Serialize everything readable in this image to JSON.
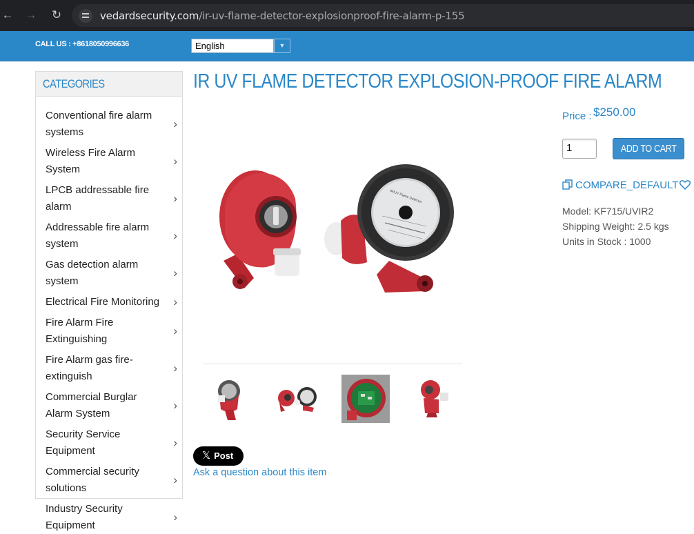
{
  "browser": {
    "back_icon": "back-arrow-icon",
    "forward_icon": "forward-arrow-icon",
    "reload_icon": "reload-icon",
    "url_domain": "vedardsecurity.com",
    "url_path": "/ir-uv-flame-detector-explosionproof-fire-alarm-p-155"
  },
  "header": {
    "call_us": "CALL US : +8618050996636",
    "language": "English"
  },
  "sidebar": {
    "title": "CATEGORIES",
    "items": [
      {
        "label": "Conventional fire alarm systems"
      },
      {
        "label": "Wireless Fire Alarm System"
      },
      {
        "label": "LPCB addressable fire alarm"
      },
      {
        "label": "Addressable fire alarm system"
      },
      {
        "label": "Gas detection alarm system"
      },
      {
        "label": "Electrical Fire Monitoring"
      },
      {
        "label": "Fire Alarm Fire Extinguishing"
      },
      {
        "label": "Fire Alarm gas fire-extinguish"
      },
      {
        "label": "Commercial Burglar Alarm System"
      },
      {
        "label": "Security Service Equipment"
      },
      {
        "label": "Commercial security solutions"
      },
      {
        "label": "Industry Security Equipment"
      }
    ]
  },
  "product": {
    "title": "IR UV FLAME DETECTOR EXPLOSION-PROOF FIRE ALARM",
    "price_label": "Price :",
    "price": "$250.00",
    "quantity": "1",
    "add_to_cart": "ADD TO CART",
    "compare": "COMPARE_DEFAULT",
    "model": "Model: KF715/UVIR2",
    "weight": "Shipping Weight: 2.5 kgs",
    "stock": "Units in Stock : 1000",
    "label_text": "IR/UV Flame Detector",
    "post": "Post",
    "ask": "Ask a question about this item"
  },
  "colors": {
    "brand_blue": "#2a87c8",
    "product_red": "#c8303a"
  }
}
